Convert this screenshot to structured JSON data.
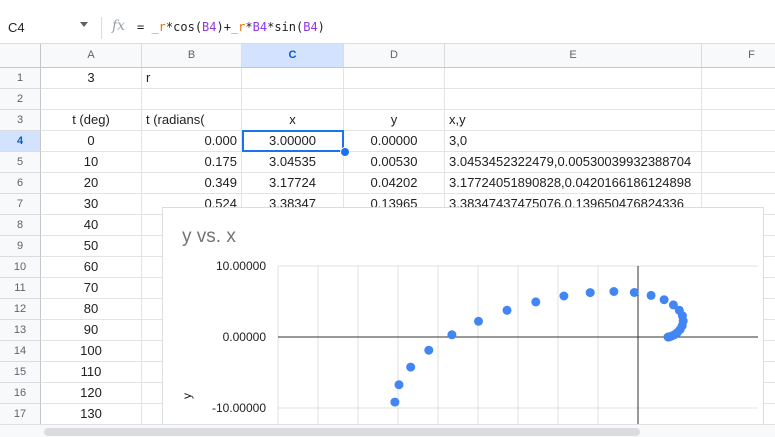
{
  "formula_bar": {
    "name_box": "C4",
    "fx_symbol": "fx",
    "formula_parts": [
      {
        "t": "=",
        "c": ""
      },
      {
        "t": " _r",
        "c": "nm"
      },
      {
        "t": "*cos(",
        "c": ""
      },
      {
        "t": "B4",
        "c": "ref"
      },
      {
        "t": ")+",
        "c": ""
      },
      {
        "t": "_r",
        "c": "nm"
      },
      {
        "t": "*",
        "c": ""
      },
      {
        "t": "B4",
        "c": "ref"
      },
      {
        "t": "*sin(",
        "c": ""
      },
      {
        "t": "B4",
        "c": "ref"
      },
      {
        "t": ")",
        "c": ""
      }
    ]
  },
  "columns": [
    "A",
    "B",
    "C",
    "D",
    "E",
    "F"
  ],
  "selected_column": "C",
  "selected_row": "4",
  "rows": [
    {
      "num": "1",
      "cells": [
        "3",
        "r",
        "",
        "",
        ""
      ]
    },
    {
      "num": "2",
      "cells": [
        "",
        "",
        "",
        "",
        ""
      ]
    },
    {
      "num": "3",
      "cells": [
        "t (deg)",
        "t (radians(",
        "x",
        "y",
        "x,y"
      ]
    },
    {
      "num": "4",
      "cells": [
        "0",
        "0.000",
        "3.00000",
        "0.00000",
        "3,0"
      ]
    },
    {
      "num": "5",
      "cells": [
        "10",
        "0.175",
        "3.04535",
        "0.00530",
        "3.0453452322479,0.00530039932388704"
      ]
    },
    {
      "num": "6",
      "cells": [
        "20",
        "0.349",
        "3.17724",
        "0.04202",
        "3.17724051890828,0.0420166186124898"
      ]
    },
    {
      "num": "7",
      "cells": [
        "30",
        "0.524",
        "3.38347",
        "0.13965",
        "3.38347437475076,0.139650476824336"
      ]
    },
    {
      "num": "8",
      "cells": [
        "40",
        "",
        "",
        "",
        ""
      ]
    },
    {
      "num": "9",
      "cells": [
        "50",
        "",
        "",
        "",
        ""
      ]
    },
    {
      "num": "10",
      "cells": [
        "60",
        "",
        "",
        "",
        ""
      ]
    },
    {
      "num": "11",
      "cells": [
        "70",
        "",
        "",
        "",
        ""
      ]
    },
    {
      "num": "12",
      "cells": [
        "80",
        "",
        "",
        "",
        ""
      ]
    },
    {
      "num": "13",
      "cells": [
        "90",
        "",
        "",
        "",
        ""
      ]
    },
    {
      "num": "14",
      "cells": [
        "100",
        "",
        "",
        "",
        ""
      ]
    },
    {
      "num": "15",
      "cells": [
        "110",
        "",
        "",
        "",
        ""
      ]
    },
    {
      "num": "16",
      "cells": [
        "120",
        "",
        "",
        "",
        ""
      ]
    },
    {
      "num": "17",
      "cells": [
        "130",
        "",
        "",
        "",
        ""
      ]
    }
  ],
  "chart": {
    "title": "y vs. x",
    "ylabel": "y",
    "ytick_labels": [
      "10.00000",
      "0.00000",
      "-10.00000"
    ],
    "marker_color": "#4285f4"
  },
  "chart_data": {
    "type": "scatter",
    "title": "y vs. x",
    "xlabel": "",
    "ylabel": "y",
    "yticks": [
      10,
      0,
      -10
    ],
    "ylim": [
      -11,
      11
    ],
    "xlim": [
      -36,
      12
    ],
    "grid": true,
    "legend": "none",
    "points": [
      [
        3,
        0
      ],
      [
        3.045,
        0.005
      ],
      [
        3.177,
        0.042
      ],
      [
        3.383,
        0.14
      ],
      [
        3.645,
        0.327
      ],
      [
        3.933,
        0.627
      ],
      [
        4.207,
        1.05
      ],
      [
        4.419,
        1.596
      ],
      [
        4.515,
        2.25
      ],
      [
        4.439,
        2.993
      ],
      [
        4.133,
        3.758
      ],
      [
        3.541,
        4.526
      ],
      [
        2.608,
        5.255
      ],
      [
        1.308,
        5.86
      ],
      [
        -0.366,
        6.27
      ],
      [
        -2.408,
        6.412
      ],
      [
        -4.777,
        6.256
      ],
      [
        -7.411,
        5.772
      ],
      [
        -10.22,
        4.944
      ],
      [
        -13.103,
        3.757
      ],
      [
        -15.945,
        2.205
      ],
      [
        -18.606,
        0.312
      ],
      [
        -20.917,
        -1.864
      ],
      [
        -22.726,
        -4.244
      ],
      [
        -23.897,
        -6.717
      ],
      [
        -24.307,
        -9.164
      ]
    ]
  }
}
